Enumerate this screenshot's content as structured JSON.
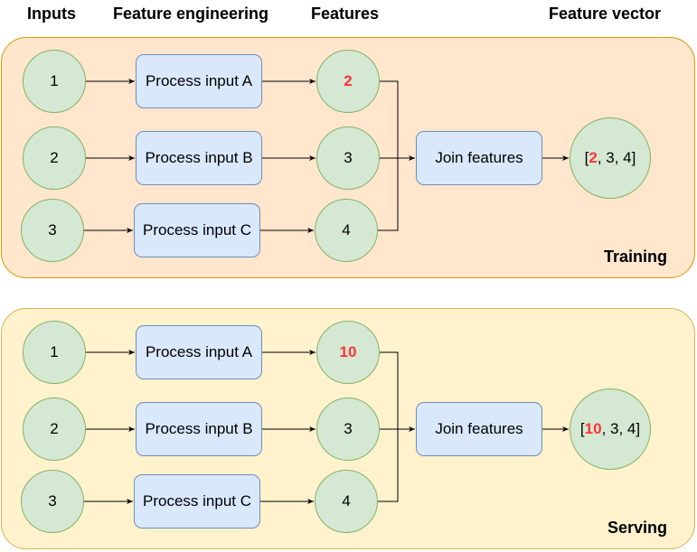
{
  "headers": {
    "inputs": "Inputs",
    "feature_engineering": "Feature engineering",
    "features": "Features",
    "feature_vector": "Feature vector"
  },
  "colors": {
    "highlight": "#ff3333",
    "training_bg": "#ffe6cc",
    "serving_bg": "#fff2cc",
    "circle_fill": "#d5e8d4",
    "box_fill": "#dae8fc"
  },
  "training": {
    "label": "Training",
    "inputs": [
      "1",
      "2",
      "3"
    ],
    "processes": [
      "Process input A",
      "Process input B",
      "Process input C"
    ],
    "features": [
      "2",
      "3",
      "4"
    ],
    "join": "Join features",
    "vector": {
      "open": "[",
      "highlight": "2",
      "rest": ", 3, 4]"
    }
  },
  "serving": {
    "label": "Serving",
    "inputs": [
      "1",
      "2",
      "3"
    ],
    "processes": [
      "Process input A",
      "Process input B",
      "Process input C"
    ],
    "features": [
      "10",
      "3",
      "4"
    ],
    "join": "Join features",
    "vector": {
      "open": "[",
      "highlight": "10",
      "rest": ", 3, 4]"
    }
  }
}
